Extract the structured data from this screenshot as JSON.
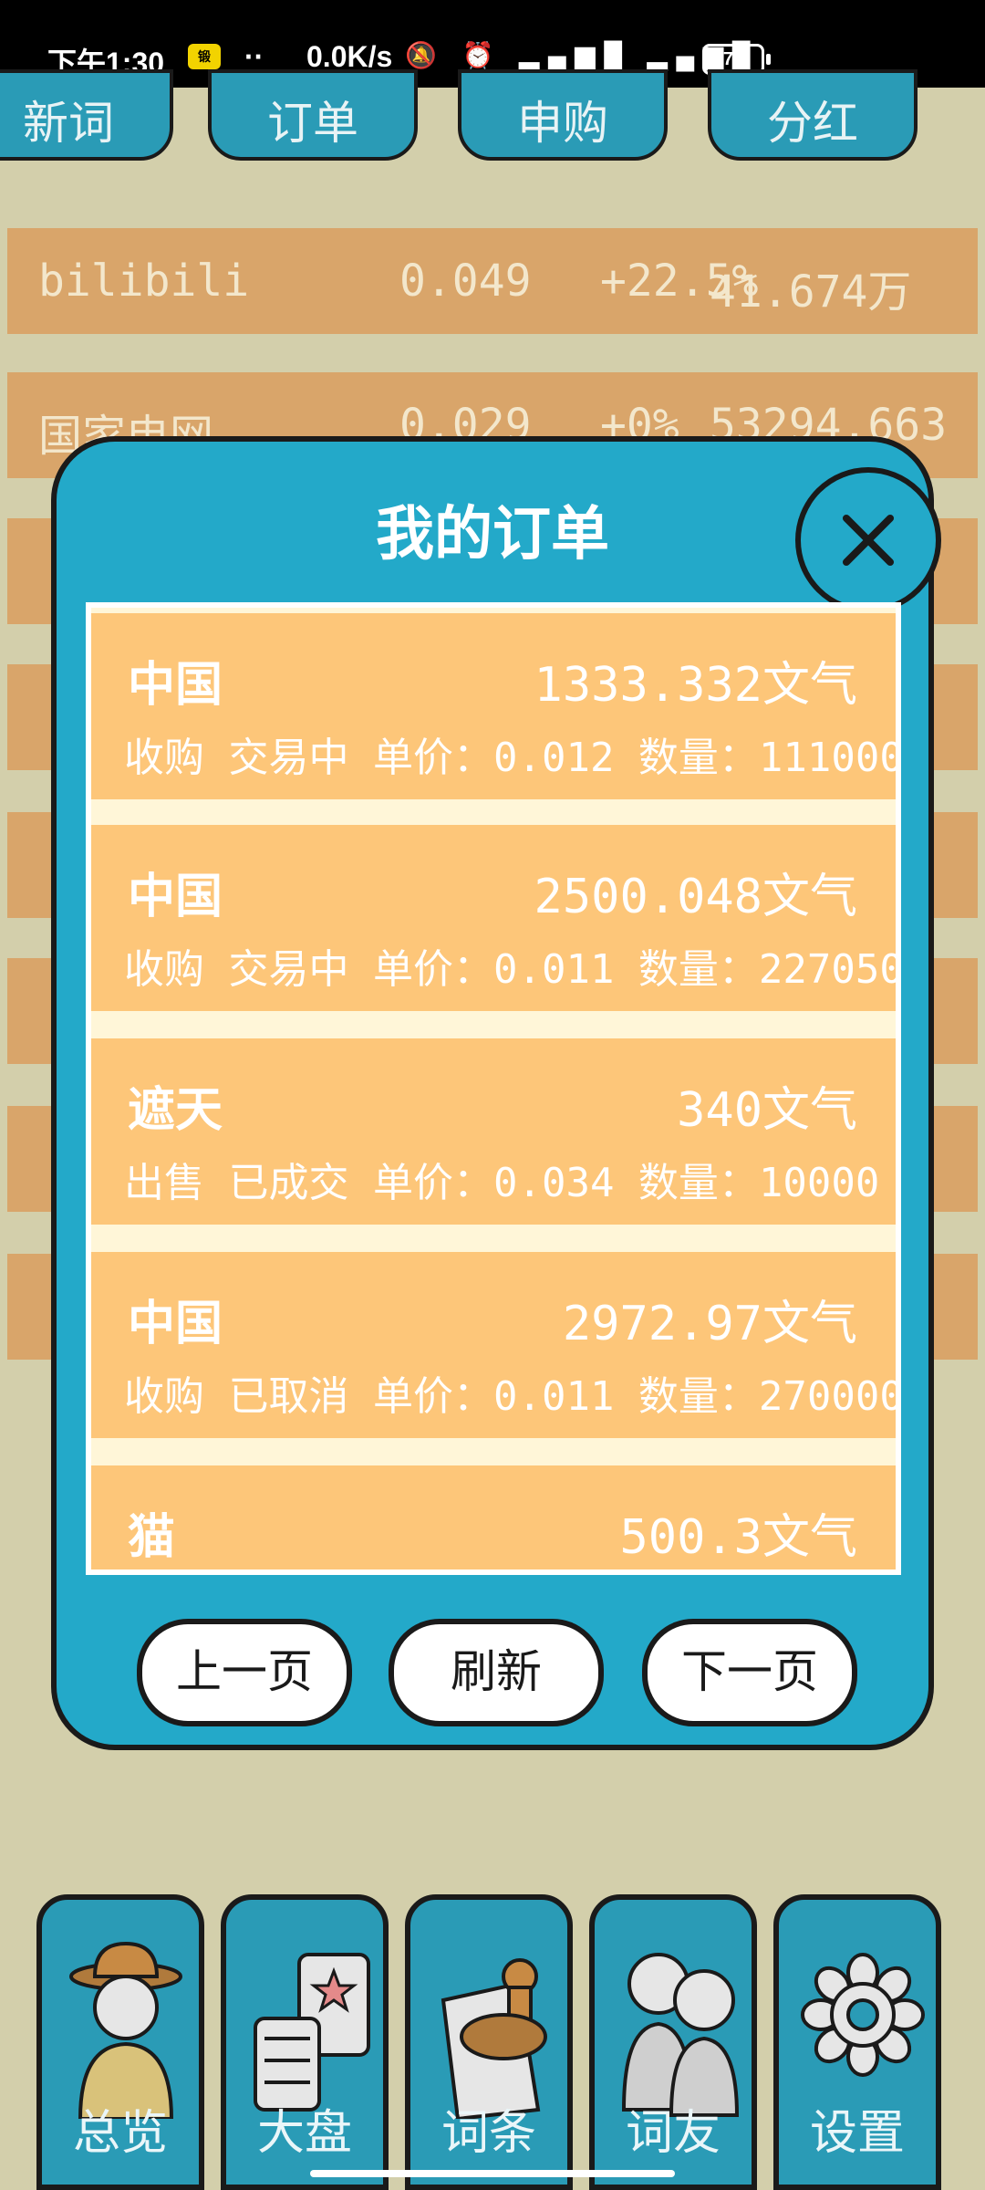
{
  "status_bar": {
    "time": "下午1:30",
    "dots": "··",
    "speed": "0.0K/s",
    "battery": "76"
  },
  "tabs": [
    "新词",
    "订单",
    "申购",
    "分红"
  ],
  "stock_rows": [
    {
      "name": "bilibili",
      "price": "0.049",
      "change": "+22.5%",
      "volume": "41.674万"
    },
    {
      "name": "国家电网",
      "price": "0.029",
      "change": "+0%",
      "volume": "53294.663"
    }
  ],
  "modal": {
    "title": "我的订单",
    "orders": [
      {
        "name": "中国",
        "amount": "1333.332文气",
        "detail": "收购 交易中 单价：0.012 数量：111000"
      },
      {
        "name": "中国",
        "amount": "2500.048文气",
        "detail": "收购 交易中 单价：0.011 数量：227050"
      },
      {
        "name": "遮天",
        "amount": "340文气",
        "detail": "出售 已成交 单价：0.034 数量：10000"
      },
      {
        "name": "中国",
        "amount": "2972.97文气",
        "detail": "收购 已取消 单价：0.011 数量：270000"
      },
      {
        "name": "猫",
        "amount": "500.3文气",
        "detail": ""
      }
    ],
    "prev_label": "上一页",
    "refresh_label": "刷新",
    "next_label": "下一页"
  },
  "nav": [
    {
      "label": "总览",
      "icon": "explorer-icon"
    },
    {
      "label": "大盘",
      "icon": "market-icon"
    },
    {
      "label": "词条",
      "icon": "stamp-icon"
    },
    {
      "label": "词友",
      "icon": "friends-icon"
    },
    {
      "label": "设置",
      "icon": "gear-icon"
    }
  ],
  "colors": {
    "background": "#d3cfab",
    "modal": "#23a9c9",
    "order": "#fdc679",
    "row": "#d9a56a"
  }
}
